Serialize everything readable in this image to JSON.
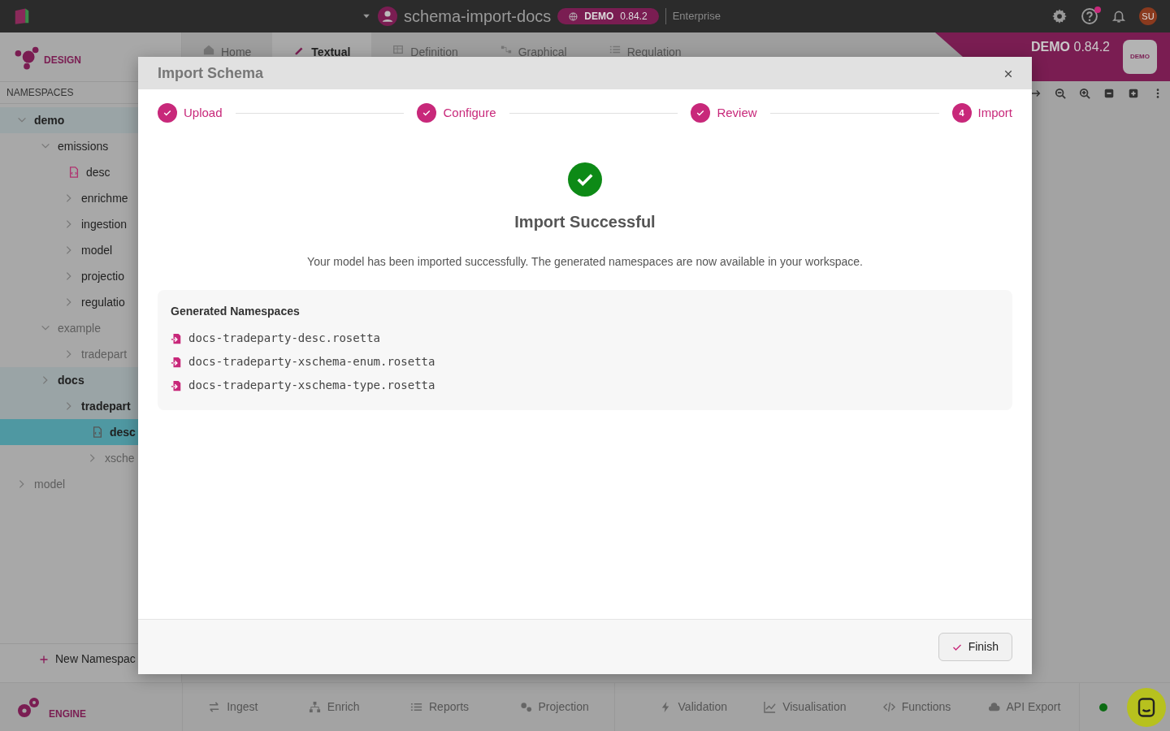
{
  "topbar": {
    "project": "schema-import-docs",
    "env_badge": {
      "label": "DEMO",
      "version": "0.84.2"
    },
    "edition": "Enterprise",
    "help_notification": true,
    "avatar": "SU"
  },
  "design": {
    "label": "DESIGN"
  },
  "view_tabs": [
    {
      "label": "Home",
      "selected": false
    },
    {
      "label": "Textual",
      "selected": true
    },
    {
      "label": "Definition",
      "selected": false
    },
    {
      "label": "Graphical",
      "selected": false
    },
    {
      "label": "Regulation",
      "selected": false
    }
  ],
  "banner": {
    "label": "DEMO",
    "version": "0.84.2",
    "logo": "DEMO"
  },
  "sidebar": {
    "heading": "NAMESPACES",
    "tree": [
      {
        "label": "demo",
        "kind": "folder",
        "expanded": true,
        "highlighted": true,
        "muted": false,
        "children": [
          {
            "label": "emissions",
            "kind": "folder",
            "expanded": true,
            "highlighted": false,
            "muted": false,
            "children": [
              {
                "label": "desc",
                "kind": "file",
                "selected": false
              },
              {
                "label": "enrichme",
                "kind": "folder",
                "expanded": false,
                "highlighted": false,
                "muted": false
              },
              {
                "label": "ingestion",
                "kind": "folder",
                "expanded": false,
                "highlighted": false,
                "muted": false
              },
              {
                "label": "model",
                "kind": "folder",
                "expanded": false,
                "highlighted": false,
                "muted": false
              },
              {
                "label": "projectio",
                "kind": "folder",
                "expanded": false,
                "highlighted": false,
                "muted": false
              },
              {
                "label": "regulatio",
                "kind": "folder",
                "expanded": false,
                "highlighted": false,
                "muted": false
              }
            ]
          },
          {
            "label": "example",
            "kind": "folder",
            "expanded": true,
            "highlighted": false,
            "muted": true,
            "children": [
              {
                "label": "tradepart",
                "kind": "folder",
                "expanded": false,
                "highlighted": false,
                "muted": true
              }
            ]
          },
          {
            "label": "docs",
            "kind": "folder",
            "expanded": false,
            "highlighted": true,
            "muted": false,
            "children": [
              {
                "label": "tradepart",
                "kind": "folder",
                "expanded": false,
                "highlighted": true,
                "muted": false,
                "children": [
                  {
                    "label": "desc",
                    "kind": "file",
                    "selected": true
                  },
                  {
                    "label": "xsche",
                    "kind": "folder",
                    "expanded": false,
                    "highlighted": false,
                    "muted": true
                  }
                ]
              }
            ]
          }
        ]
      },
      {
        "label": "model",
        "kind": "folder",
        "expanded": false,
        "highlighted": false,
        "muted": true
      }
    ],
    "new_button": "New Namespac"
  },
  "modal": {
    "title": "Import Schema",
    "steps": [
      {
        "label": "Upload",
        "done": true
      },
      {
        "label": "Configure",
        "done": true
      },
      {
        "label": "Review",
        "done": true
      },
      {
        "label": "Import",
        "done": false,
        "number": "4"
      }
    ],
    "success": {
      "title": "Import Successful",
      "message": "Your model has been imported successfully. The generated namespaces are now available in your workspace."
    },
    "namespaces": {
      "heading": "Generated Namespaces",
      "items": [
        "docs-tradeparty-desc.rosetta",
        "docs-tradeparty-xschema-enum.rosetta",
        "docs-tradeparty-xschema-type.rosetta"
      ]
    },
    "finish_button": "Finish"
  },
  "engine": {
    "label": "ENGINE"
  },
  "bottom_tabs": [
    {
      "label": "Ingest"
    },
    {
      "label": "Enrich"
    },
    {
      "label": "Reports"
    },
    {
      "label": "Projection"
    }
  ],
  "bottom_tabs_right": [
    {
      "label": "Validation"
    },
    {
      "label": "Visualisation"
    },
    {
      "label": "Functions"
    },
    {
      "label": "API Export"
    }
  ],
  "status": {
    "color": "#0b6b12"
  }
}
